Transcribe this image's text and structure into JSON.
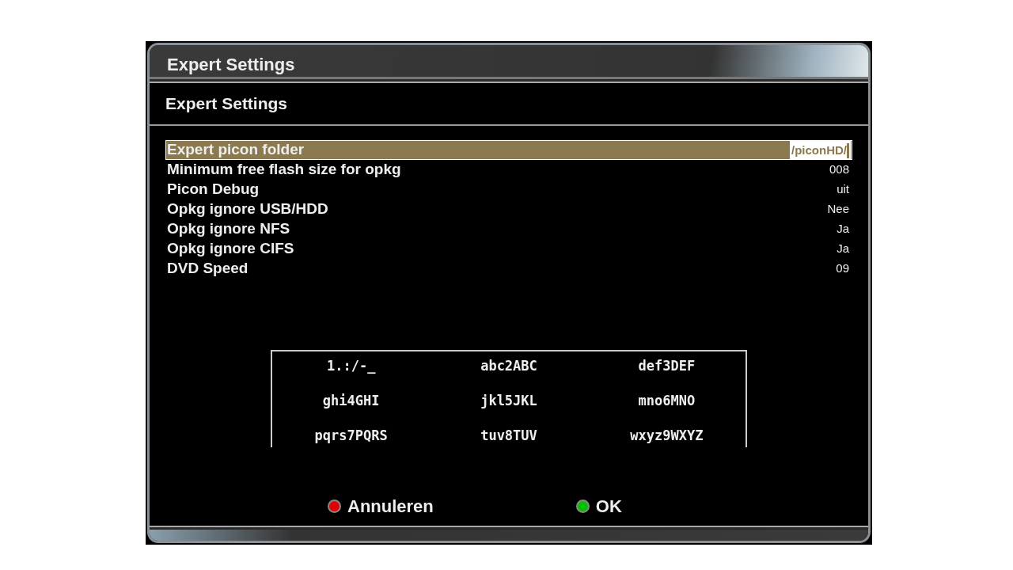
{
  "window": {
    "title": "Expert Settings"
  },
  "screen_title": "Expert Settings",
  "settings": [
    {
      "label": "Expert picon folder",
      "value": "/piconHD/",
      "selected": true
    },
    {
      "label": "Minimum free flash size for opkg",
      "value": "008",
      "selected": false
    },
    {
      "label": "Picon Debug",
      "value": "uit",
      "selected": false
    },
    {
      "label": "Opkg ignore USB/HDD",
      "value": "Nee",
      "selected": false
    },
    {
      "label": "Opkg ignore NFS",
      "value": "Ja",
      "selected": false
    },
    {
      "label": "Opkg ignore CIFS",
      "value": "Ja",
      "selected": false
    },
    {
      "label": "DVD Speed",
      "value": "09",
      "selected": false
    }
  ],
  "keypad": [
    "1.:/-_",
    "abc2ABC",
    "def3DEF",
    "ghi4GHI",
    "jkl5JKL",
    "mno6MNO",
    "pqrs7PQRS",
    "tuv8TUV",
    "wxyz9WXYZ"
  ],
  "buttons": [
    {
      "label": "Annuleren",
      "color": "#e00000"
    },
    {
      "label": "OK",
      "color": "#00c000"
    }
  ]
}
